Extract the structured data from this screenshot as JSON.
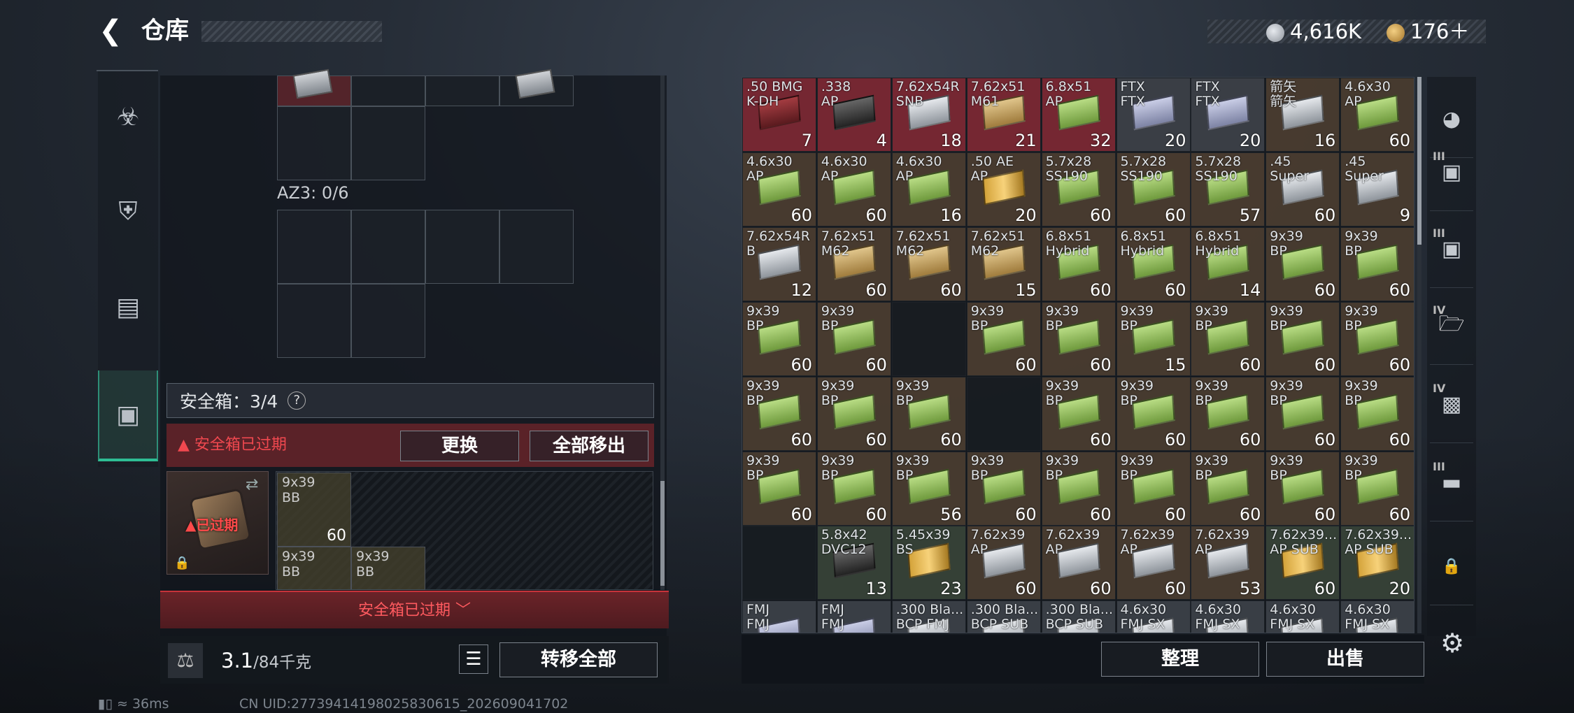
{
  "header": {
    "title": "仓库",
    "currency1": "4,616K",
    "currency2": "176＋"
  },
  "left_nav": [
    "pistol-icon",
    "armor-icon",
    "backpack-icon",
    "briefcase-icon"
  ],
  "left_panel": {
    "az3_label": "AZ3: 0/6",
    "safebox_label": "安全箱：3/4",
    "help": "?",
    "warning": "▲ 安全箱已过期",
    "replace_button": "更换",
    "move_all_button": "全部移出",
    "case_expired": "▲已过期",
    "safe_items": [
      {
        "text": "9x39\nBB",
        "qty": "60"
      },
      {
        "text": "9x39\nBB",
        "qty": ""
      },
      {
        "text": "9x39\nBB",
        "qty": ""
      }
    ],
    "expired_banner": "安全箱已过期 ﹀",
    "weight_value": "3.1",
    "weight_unit": "/84千克",
    "transfer_button": "转移全部"
  },
  "stash": {
    "sort_button": "整理",
    "sell_button": "出售",
    "items": [
      {
        "t": ".50 BMG\nK-DH",
        "q": "7",
        "bg": "red",
        "box": "red"
      },
      {
        "t": ".338\nAP",
        "q": "4",
        "bg": "red",
        "box": "dark"
      },
      {
        "t": "7.62x54R\nSNB",
        "q": "18",
        "bg": "red",
        "box": "silver"
      },
      {
        "t": "7.62x51\nM61",
        "q": "21",
        "bg": "red",
        "box": "tan"
      },
      {
        "t": "6.8x51\nAP",
        "q": "32",
        "bg": "red",
        "box": "green"
      },
      {
        "t": "FTX\nFTX",
        "q": "20",
        "bg": "grey",
        "box": "lav"
      },
      {
        "t": "FTX\nFTX",
        "q": "20",
        "bg": "grey",
        "box": "lav"
      },
      {
        "t": "箭矢\n箭矢",
        "q": "16",
        "bg": "brown",
        "box": "silver"
      },
      {
        "t": "4.6x30\nAP",
        "q": "60",
        "bg": "brown",
        "box": "green"
      },
      {
        "t": "4.6x30\nAP",
        "q": "60",
        "bg": "brown",
        "box": "green"
      },
      {
        "t": "4.6x30\nAP",
        "q": "60",
        "bg": "brown",
        "box": "green"
      },
      {
        "t": "4.6x30\nAP",
        "q": "16",
        "bg": "brown",
        "box": "green"
      },
      {
        "t": ".50 AE\nAP",
        "q": "20",
        "bg": "brown",
        "box": "bullet"
      },
      {
        "t": "5.7x28\nSS190",
        "q": "60",
        "bg": "brown",
        "box": "green"
      },
      {
        "t": "5.7x28\nSS190",
        "q": "60",
        "bg": "brown",
        "box": "green"
      },
      {
        "t": "5.7x28\nSS190",
        "q": "57",
        "bg": "brown",
        "box": "green"
      },
      {
        "t": ".45\nSuper",
        "q": "60",
        "bg": "brown",
        "box": "silver"
      },
      {
        "t": ".45\nSuper",
        "q": "9",
        "bg": "brown",
        "box": "silver"
      },
      {
        "t": "7.62x54R\nB",
        "q": "12",
        "bg": "brown",
        "box": "silver"
      },
      {
        "t": "7.62x51\nM62",
        "q": "60",
        "bg": "brown",
        "box": "tan"
      },
      {
        "t": "7.62x51\nM62",
        "q": "60",
        "bg": "brown",
        "box": "tan"
      },
      {
        "t": "7.62x51\nM62",
        "q": "15",
        "bg": "brown",
        "box": "tan"
      },
      {
        "t": "6.8x51\nHybrid",
        "q": "60",
        "bg": "brown",
        "box": "green"
      },
      {
        "t": "6.8x51\nHybrid",
        "q": "60",
        "bg": "brown",
        "box": "green"
      },
      {
        "t": "6.8x51\nHybrid",
        "q": "14",
        "bg": "brown",
        "box": "green"
      },
      {
        "t": "9x39\nBP",
        "q": "60",
        "bg": "brown",
        "box": "green"
      },
      {
        "t": "9x39\nBP",
        "q": "60",
        "bg": "brown",
        "box": "green"
      },
      {
        "t": "9x39\nBP",
        "q": "60",
        "bg": "brown",
        "box": "green"
      },
      {
        "t": "9x39\nBP",
        "q": "60",
        "bg": "brown",
        "box": "green"
      },
      {
        "t": "",
        "q": "",
        "bg": "empty",
        "box": ""
      },
      {
        "t": "9x39\nBP",
        "q": "60",
        "bg": "brown",
        "box": "green"
      },
      {
        "t": "9x39\nBP",
        "q": "60",
        "bg": "brown",
        "box": "green"
      },
      {
        "t": "9x39\nBP",
        "q": "15",
        "bg": "brown",
        "box": "green"
      },
      {
        "t": "9x39\nBP",
        "q": "60",
        "bg": "brown",
        "box": "green"
      },
      {
        "t": "9x39\nBP",
        "q": "60",
        "bg": "brown",
        "box": "green"
      },
      {
        "t": "9x39\nBP",
        "q": "60",
        "bg": "brown",
        "box": "green"
      },
      {
        "t": "9x39\nBP",
        "q": "60",
        "bg": "brown",
        "box": "green"
      },
      {
        "t": "9x39\nBP",
        "q": "60",
        "bg": "brown",
        "box": "green"
      },
      {
        "t": "9x39\nBP",
        "q": "60",
        "bg": "brown",
        "box": "green"
      },
      {
        "t": "",
        "q": "",
        "bg": "empty",
        "box": ""
      },
      {
        "t": "9x39\nBP",
        "q": "60",
        "bg": "brown",
        "box": "green"
      },
      {
        "t": "9x39\nBP",
        "q": "60",
        "bg": "brown",
        "box": "green"
      },
      {
        "t": "9x39\nBP",
        "q": "60",
        "bg": "brown",
        "box": "green"
      },
      {
        "t": "9x39\nBP",
        "q": "60",
        "bg": "brown",
        "box": "green"
      },
      {
        "t": "9x39\nBP",
        "q": "60",
        "bg": "brown",
        "box": "green"
      },
      {
        "t": "9x39\nBP",
        "q": "60",
        "bg": "brown",
        "box": "green"
      },
      {
        "t": "9x39\nBP",
        "q": "60",
        "bg": "brown",
        "box": "green"
      },
      {
        "t": "9x39\nBP",
        "q": "56",
        "bg": "brown",
        "box": "green"
      },
      {
        "t": "9x39\nBP",
        "q": "60",
        "bg": "brown",
        "box": "green"
      },
      {
        "t": "9x39\nBP",
        "q": "60",
        "bg": "brown",
        "box": "green"
      },
      {
        "t": "9x39\nBP",
        "q": "60",
        "bg": "brown",
        "box": "green"
      },
      {
        "t": "9x39\nBP",
        "q": "60",
        "bg": "brown",
        "box": "green"
      },
      {
        "t": "9x39\nBP",
        "q": "60",
        "bg": "brown",
        "box": "green"
      },
      {
        "t": "9x39\nBP",
        "q": "60",
        "bg": "brown",
        "box": "green"
      },
      {
        "t": "",
        "q": "",
        "bg": "empty",
        "box": ""
      },
      {
        "t": "5.8x42\nDVC12",
        "q": "13",
        "bg": "green",
        "box": "dark"
      },
      {
        "t": "5.45x39\nBS",
        "q": "23",
        "bg": "green",
        "box": "bullet"
      },
      {
        "t": "7.62x39\nAP",
        "q": "60",
        "bg": "brown",
        "box": "silver"
      },
      {
        "t": "7.62x39\nAP",
        "q": "60",
        "bg": "brown",
        "box": "silver"
      },
      {
        "t": "7.62x39\nAP",
        "q": "60",
        "bg": "brown",
        "box": "silver"
      },
      {
        "t": "7.62x39\nAP",
        "q": "53",
        "bg": "brown",
        "box": "silver"
      },
      {
        "t": "7.62x39...\nAP SUB",
        "q": "60",
        "bg": "green",
        "box": "bullet"
      },
      {
        "t": "7.62x39...\nAP SUB",
        "q": "20",
        "bg": "green",
        "box": "bullet"
      },
      {
        "t": "FMJ\nFMJ",
        "q": "",
        "bg": "grey",
        "box": "lav"
      },
      {
        "t": "FMJ\nFMJ",
        "q": "",
        "bg": "grey",
        "box": "lav"
      },
      {
        "t": ".300 Bla...\nBCP FMJ",
        "q": "",
        "bg": "grey",
        "box": "silver"
      },
      {
        "t": ".300 Bla...\nBCP SUB",
        "q": "",
        "bg": "grey",
        "box": "silver"
      },
      {
        "t": ".300 Bla...\nBCP SUB",
        "q": "",
        "bg": "grey",
        "box": "silver"
      },
      {
        "t": "4.6x30\nFMJ SX",
        "q": "",
        "bg": "grey",
        "box": "silver"
      },
      {
        "t": "4.6x30\nFMJ SX",
        "q": "",
        "bg": "grey",
        "box": "silver"
      },
      {
        "t": "4.6x30\nFMJ SX",
        "q": "",
        "bg": "grey",
        "box": "silver"
      },
      {
        "t": "4.6x30\nFMJ SX",
        "q": "",
        "bg": "grey",
        "box": "silver"
      }
    ]
  },
  "right_nav": [
    {
      "icon": "helmet-icon",
      "lvl": ""
    },
    {
      "icon": "armor-vest-icon",
      "lvl": "III"
    },
    {
      "icon": "armor-plate-icon",
      "lvl": "III"
    },
    {
      "icon": "folder-icon",
      "lvl": "IV"
    },
    {
      "icon": "medkit-icon",
      "lvl": "IV"
    },
    {
      "icon": "rifle-icon",
      "lvl": "III"
    },
    {
      "icon": "lock-icon",
      "lvl": ""
    }
  ],
  "status": {
    "ping": "36ms",
    "uid": "CN UID:27739414198025830615_202609041702"
  }
}
